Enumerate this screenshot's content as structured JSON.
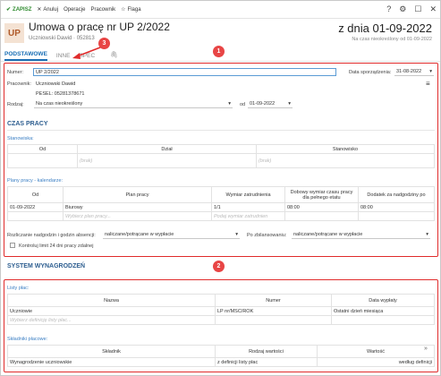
{
  "toolbar": {
    "save": "ZAPISZ",
    "cancel": "Anuluj",
    "operations": "Operacje",
    "employee": "Pracownik",
    "flag": "Flaga",
    "icons": [
      "help-icon",
      "gear-icon",
      "maximize-icon",
      "close-icon"
    ]
  },
  "header": {
    "badge": "UP",
    "title": "Umowa o pracę nr UP 2/2022",
    "subtitle_name": "Uczniowski Dawid",
    "subtitle_pesel": "· 052813",
    "date_title": "z dnia 01-09-2022",
    "date_sub": "Na czas nieokreślony od 01-09-2022"
  },
  "tabs": [
    "PODSTAWOWE",
    "INNE",
    "SPEC"
  ],
  "markers": [
    "1",
    "2",
    "3"
  ],
  "form": {
    "number_label": "Numer:",
    "number_value": "UP 2/2022",
    "date_label": "Data sporządzenia:",
    "date_value": "31-08-2022",
    "employee_label": "Pracownik:",
    "employee_value": "Uczniowski Dawid",
    "pesel_value": "PESEL: 05281378671",
    "type_label": "Rodzaj:",
    "type_value": "Na czas nieokreślony",
    "from_label": "od",
    "from_value": "01-09-2022"
  },
  "czas_pracy": {
    "title": "CZAS PRACY",
    "stanowiska_label": "Stanowiska:",
    "stanowiska_headers": [
      "Od",
      "Dział",
      "Stanowisko"
    ],
    "stanowiska_placeholder": "(brak)",
    "plany_label": "Plany pracy - kalendarze:",
    "plany_headers": [
      "Od",
      "Plan pracy",
      "Wymiar zatrudnienia",
      "Dobowy wymiar czasu pracy dla pełnego etatu",
      "Dodatek za nadgodziny po"
    ],
    "plany_row": [
      "01-09-2022",
      "Biurowy",
      "1/1",
      "08:00",
      "08:00"
    ],
    "plany_placeholder_plan": "Wybierz plan pracy...",
    "plany_placeholder_wymiar": "Podaj wymiar zatrudnien",
    "rozliczanie_label": "Rozliczanie nadgodzin i godzin absencji:",
    "rozliczanie_value": "naliczane/potrącane w wypłacie",
    "po_zbilansowaniu_label": "Po zbilansowaniu:",
    "po_zbilansowaniu_value": "naliczane/potrącane w wypłacie",
    "kontroluj_label": "Kontroluj limit 24 dni pracy zdalnej"
  },
  "wynagrodzenia": {
    "title": "SYSTEM WYNAGRODZEŃ",
    "listy_label": "Listy płac:",
    "listy_headers": [
      "Nazwa",
      "Numer",
      "Data wypłaty"
    ],
    "listy_row": [
      "Uczniowie",
      "LP nr/MSC/ROK",
      "Ostatni dzień miesiąca"
    ],
    "listy_placeholder": "Wybierz definicję listy płac...",
    "skladniki_label": "Składniki płacowe:",
    "skladniki_headers": [
      "Składnik",
      "Rodzaj wartości",
      "Wartość"
    ],
    "skladniki_row": [
      "Wynagrodzenie uczniowskie",
      "z definicji listy płac",
      "według definicji"
    ]
  },
  "colors": {
    "accent": "#1a6fb5",
    "marker": "#e84545",
    "highlight_border": "#e02b2b",
    "save": "#2e8b2e"
  }
}
